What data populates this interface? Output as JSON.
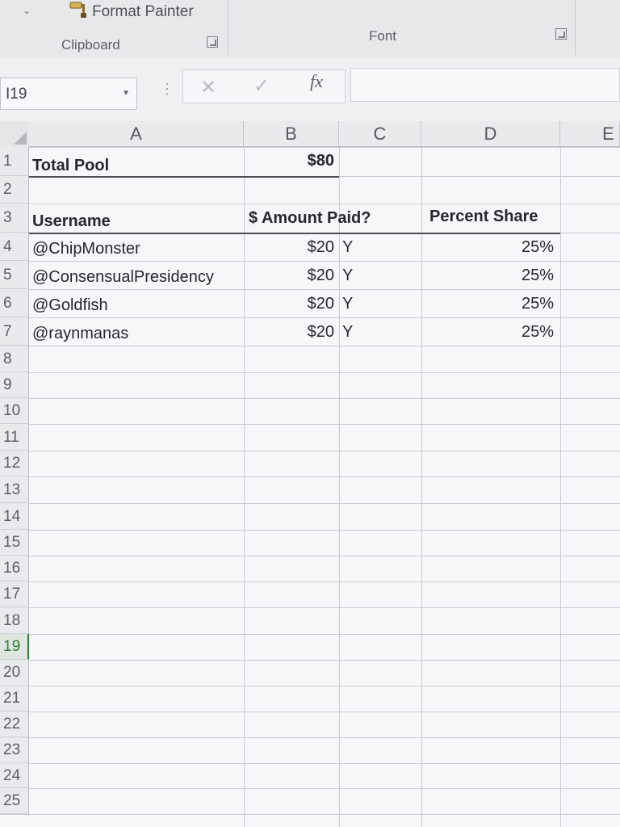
{
  "ribbon": {
    "format_painter_label": "Format Painter",
    "clipboard_group_label": "Clipboard",
    "font_group_label": "Font"
  },
  "formula_bar": {
    "name_box_value": "I19",
    "fx_label": "fx",
    "formula_value": ""
  },
  "columns": [
    "A",
    "B",
    "C",
    "D",
    "E"
  ],
  "rows": [
    "1",
    "2",
    "3",
    "4",
    "5",
    "6",
    "7",
    "8",
    "9",
    "10",
    "11",
    "12",
    "13",
    "14",
    "15",
    "16",
    "17",
    "18",
    "19",
    "20",
    "21",
    "22",
    "23",
    "24",
    "25"
  ],
  "active_row": "19",
  "sheet": {
    "row1": {
      "a": "Total Pool",
      "b": "$80"
    },
    "headers": {
      "a": "Username",
      "b": "$ Amount Paid?",
      "d": "Percent Share"
    },
    "entries": [
      {
        "username": "@ChipMonster",
        "amount": "$20",
        "paid": "Y",
        "share": "25%"
      },
      {
        "username": "@ConsensualPresidency",
        "amount": "$20",
        "paid": "Y",
        "share": "25%"
      },
      {
        "username": "@Goldfish",
        "amount": "$20",
        "paid": "Y",
        "share": "25%"
      },
      {
        "username": "@raynmanas",
        "amount": "$20",
        "paid": "Y",
        "share": "25%"
      }
    ]
  }
}
